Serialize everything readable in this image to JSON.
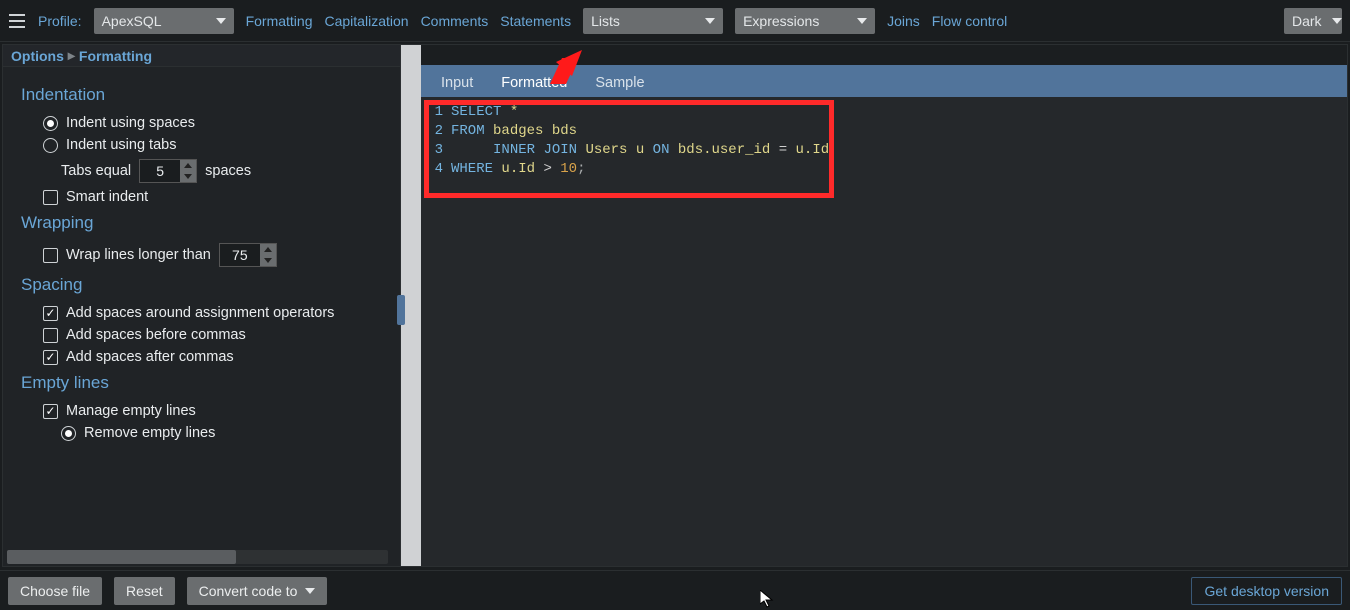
{
  "toolbar": {
    "profile_label": "Profile:",
    "profile_value": "ApexSQL",
    "menu": {
      "formatting": "Formatting",
      "capitalization": "Capitalization",
      "comments": "Comments",
      "statements": "Statements"
    },
    "lists_label": "Lists",
    "expressions_label": "Expressions",
    "joins": "Joins",
    "flow": "Flow control",
    "theme_label": "Dark"
  },
  "breadcrumb": {
    "root": "Options",
    "current": "Formatting"
  },
  "options": {
    "indentation": {
      "heading": "Indentation",
      "spaces": "Indent using spaces",
      "tabs": "Indent using tabs",
      "tabs_equal_pre": "Tabs equal",
      "tabs_equal_value": "5",
      "tabs_equal_post": "spaces",
      "smart": "Smart indent"
    },
    "wrapping": {
      "heading": "Wrapping",
      "wrap_label": "Wrap lines longer than",
      "wrap_value": "75"
    },
    "spacing": {
      "heading": "Spacing",
      "around_assign": "Add spaces around assignment operators",
      "before_commas": "Add spaces before commas",
      "after_commas": "Add spaces after commas"
    },
    "empty": {
      "heading": "Empty lines",
      "manage": "Manage empty lines",
      "remove": "Remove empty lines"
    }
  },
  "tabs": {
    "input": "Input",
    "formatted": "Formatted",
    "sample": "Sample"
  },
  "code": {
    "l1": {
      "n": "1",
      "kw": "SELECT",
      "rest": " *"
    },
    "l2": {
      "n": "2",
      "kw": "FROM",
      "t1": " badges bds"
    },
    "l3": {
      "n": "3",
      "pad": "     ",
      "kw1": "INNER",
      "kw2": "JOIN",
      "t": " Users u ",
      "kw3": "ON",
      "expr_a": " bds.user_id ",
      "eq": "=",
      "expr_b": " u.Id"
    },
    "l4": {
      "n": "4",
      "kw": "WHERE",
      "t": " u.Id ",
      "op": ">",
      "sp": " ",
      "num": "10",
      "semi": ";"
    }
  },
  "footer": {
    "choose": "Choose file",
    "reset": "Reset",
    "convert": "Convert code to",
    "desktop": "Get desktop version"
  }
}
